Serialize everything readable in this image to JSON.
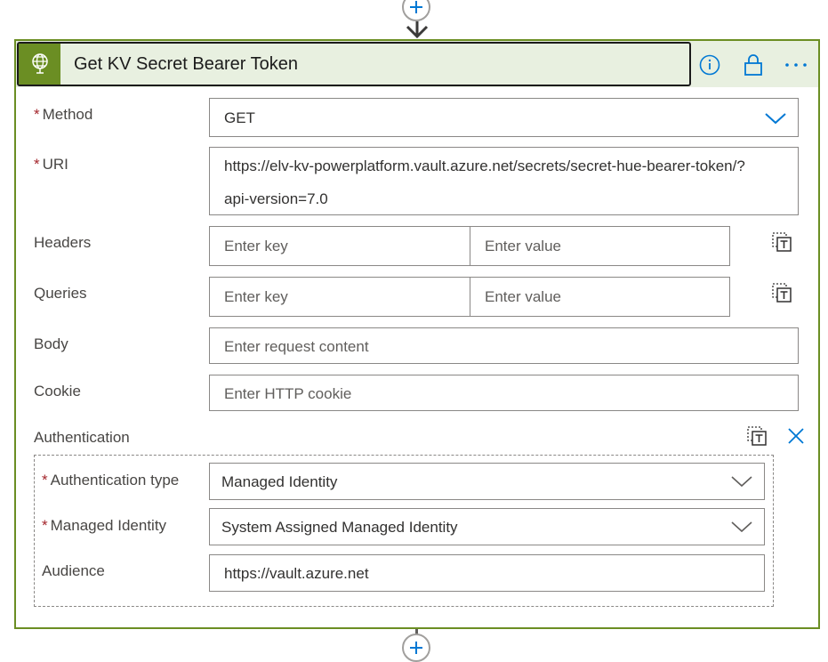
{
  "card": {
    "title": "Get KV Secret Bearer Token",
    "accent_color": "#6b8e23",
    "header_icons": [
      "info-icon",
      "lock-icon",
      "more-icon"
    ]
  },
  "fields": {
    "method": {
      "label": "Method",
      "value": "GET"
    },
    "uri": {
      "label": "URI",
      "value_line1": "https://elv-kv-powerplatform.vault.azure.net/secrets/secret-hue-bearer-token/?",
      "value_line2": "api-version=7.0"
    },
    "headers": {
      "label": "Headers",
      "key_placeholder": "Enter key",
      "value_placeholder": "Enter value"
    },
    "queries": {
      "label": "Queries",
      "key_placeholder": "Enter key",
      "value_placeholder": "Enter value"
    },
    "body": {
      "label": "Body",
      "placeholder": "Enter request content"
    },
    "cookie": {
      "label": "Cookie",
      "placeholder": "Enter HTTP cookie"
    }
  },
  "authentication": {
    "label": "Authentication",
    "type": {
      "label": "Authentication type",
      "value": "Managed Identity"
    },
    "identity": {
      "label": "Managed Identity",
      "value": "System Assigned Managed Identity"
    },
    "audience": {
      "label": "Audience",
      "value": "https://vault.azure.net"
    }
  },
  "required_marker": "*"
}
